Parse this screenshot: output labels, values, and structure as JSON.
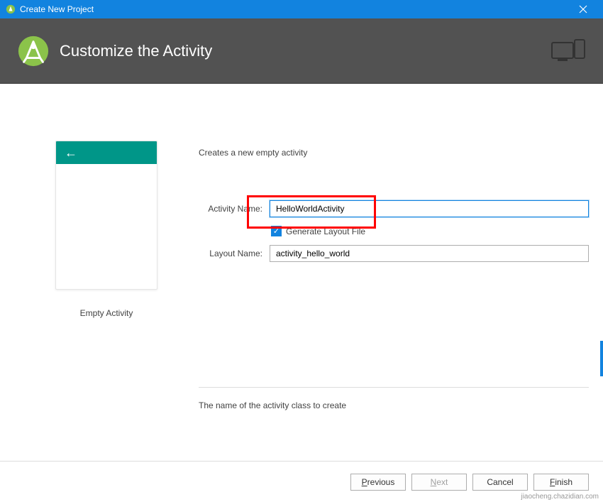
{
  "window": {
    "title": "Create New Project"
  },
  "header": {
    "title": "Customize the Activity"
  },
  "preview": {
    "label": "Empty Activity"
  },
  "form": {
    "description": "Creates a new empty activity",
    "activity_name_label": "Activity Name:",
    "activity_name_value": "HelloWorldActivity",
    "generate_layout_label": "Generate Layout File",
    "generate_layout_checked": true,
    "layout_name_label": "Layout Name:",
    "layout_name_value": "activity_hello_world",
    "help_text": "The name of the activity class to create"
  },
  "footer": {
    "previous": "Previous",
    "next": "Next",
    "cancel": "Cancel",
    "finish": "Finish"
  },
  "watermark": "jiaocheng.chazidian.com"
}
